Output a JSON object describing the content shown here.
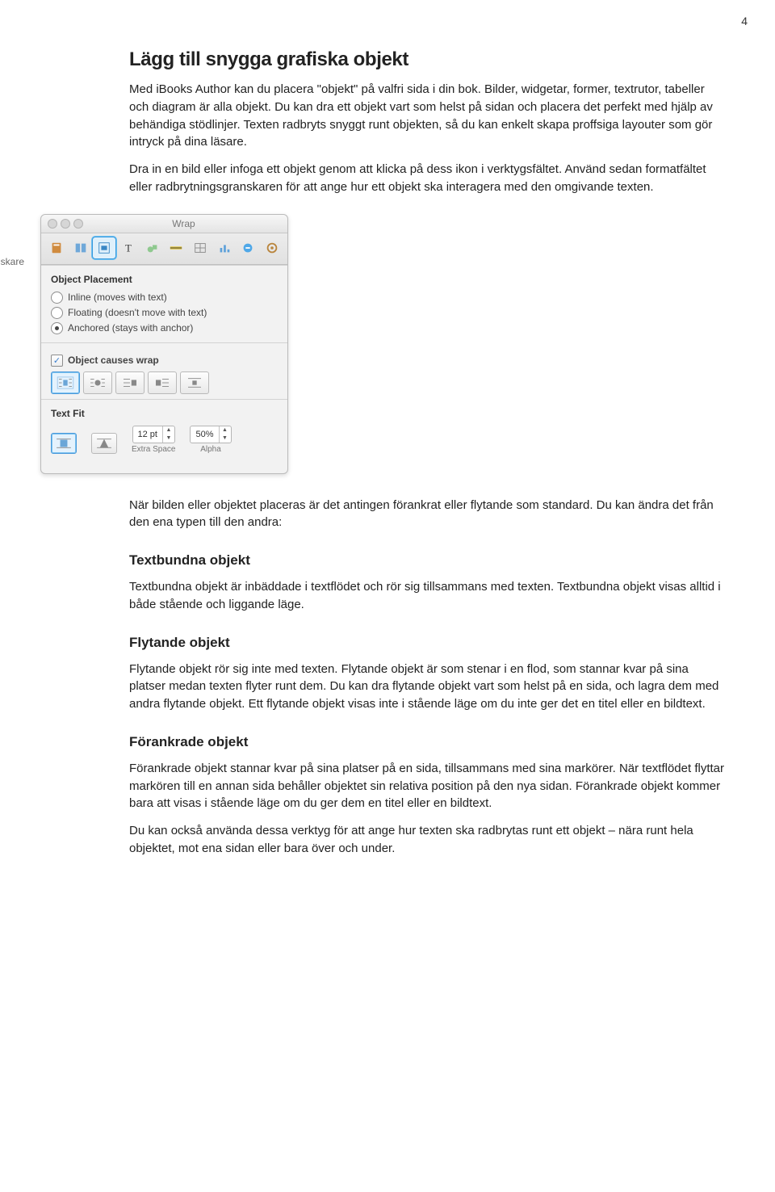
{
  "page_number": "4",
  "heading_main": "Lägg till snygga grafiska objekt",
  "intro_p1": "Med iBooks Author kan du placera \"objekt\" på valfri sida i din bok. Bilder, widgetar, former, textrutor, tabeller och diagram är alla objekt. Du kan dra ett objekt vart som helst på sidan och placera det perfekt med hjälp av behändiga stödlinjer. Texten radbryts snyggt runt objekten, så du kan enkelt skapa proffsiga layouter som gör intryck på dina läsare.",
  "intro_p2": "Dra in en bild eller infoga ett objekt genom att klicka på dess ikon i verktygsfältet. Använd sedan formatfältet eller radbrytningsgranskaren för att ange hur ett objekt ska interagera med den omgivande texten.",
  "callout_label": "Radbrytningsgranskare",
  "inspector": {
    "window_title": "Wrap",
    "object_placement": {
      "heading": "Object Placement",
      "inline": "Inline (moves with text)",
      "floating": "Floating (doesn't move with text)",
      "anchored": "Anchored (stays with anchor)",
      "selected": "anchored"
    },
    "causes_wrap_label": "Object causes wrap",
    "text_fit": {
      "heading": "Text Fit",
      "extra_space_value": "12 pt",
      "extra_space_label": "Extra Space",
      "alpha_value": "50%",
      "alpha_label": "Alpha"
    }
  },
  "after_p1": "När bilden eller objektet placeras är det antingen förankrat eller flytande som standard. Du kan ändra det från den ena typen till den andra:",
  "sub1_h": "Textbundna objekt",
  "sub1_p": "Textbundna objekt är inbäddade i textflödet och rör sig tillsammans med texten. Textbundna objekt visas alltid i både stående och liggande läge.",
  "sub2_h": "Flytande objekt",
  "sub2_p": "Flytande objekt rör sig inte med texten. Flytande objekt är som stenar i en flod, som stannar kvar på sina platser medan texten flyter runt dem. Du kan dra flytande objekt vart som helst på en sida, och lagra dem med andra flytande objekt. Ett flytande objekt visas inte i stående läge om du inte ger det en titel eller en bildtext.",
  "sub3_h": "Förankrade objekt",
  "sub3_p": "Förankrade objekt stannar kvar på sina platser på en sida, tillsammans med sina markörer. När textflödet flyttar markören till en annan sida behåller objektet sin relativa position på den nya sidan. Förankrade objekt kommer bara att visas i stående läge om du ger dem en titel eller en bildtext.",
  "final_p": "Du kan också använda dessa verktyg för att ange hur texten ska radbrytas runt ett objekt – nära runt hela objektet, mot ena sidan eller bara över och under."
}
